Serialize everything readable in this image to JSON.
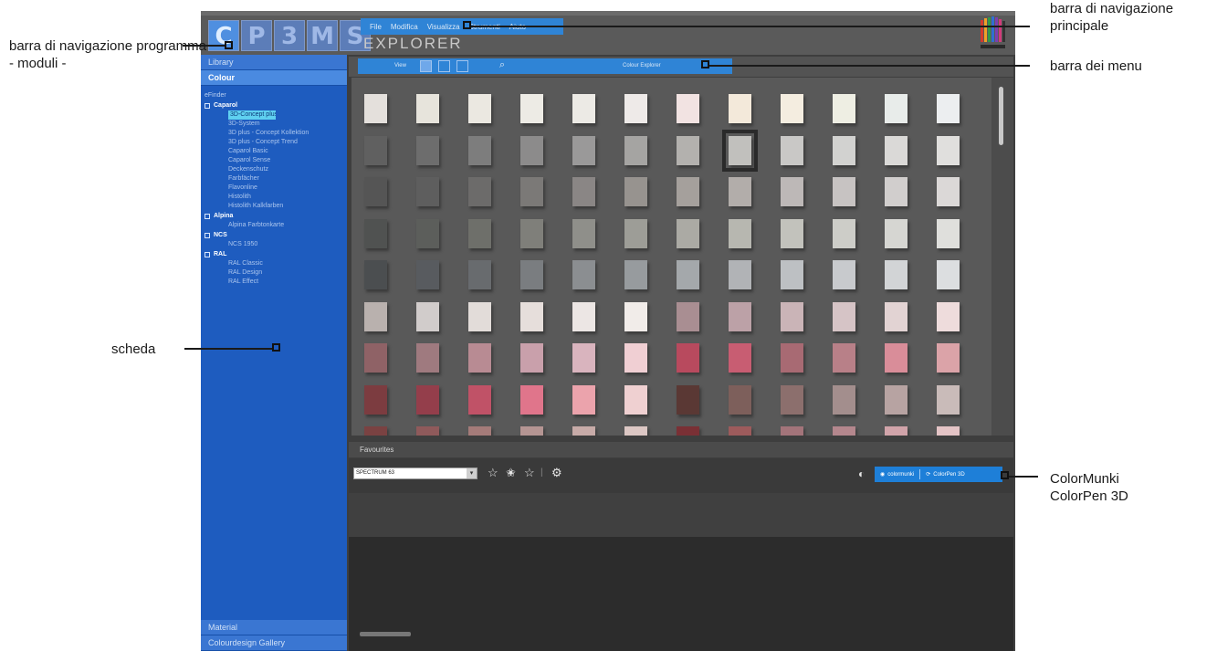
{
  "app": {
    "title": "EXPLORER",
    "modules": [
      "C",
      "P",
      "3",
      "M",
      "S"
    ],
    "main_menu": [
      "File",
      "Modifica",
      "Visualizza",
      "Strumenti",
      "Aiuto"
    ],
    "logo_icon": "brand-logo-icon"
  },
  "sidebar": {
    "headers": [
      "Library",
      "Colour"
    ],
    "tree_root": "eFinder",
    "groups": [
      {
        "name": "Caparol",
        "items": [
          "3D-Concept plus",
          "3D-System",
          "3D plus - Concept Kollektion",
          "3D plus - Concept Trend",
          "Caparol Basic",
          "Caparol Sense",
          "Deckenschutz",
          "Farbfächer",
          "Flavonline",
          "Histolith",
          "Histolith Kalkfarben"
        ]
      },
      {
        "name": "Alpina",
        "items": [
          "Alpina Farbtonkarte"
        ]
      },
      {
        "name": "NCS",
        "items": [
          "NCS 1950"
        ]
      },
      {
        "name": "RAL",
        "items": [
          "RAL Classic",
          "RAL Design",
          "RAL Effect"
        ]
      }
    ],
    "selected_item": "3D-Concept plus",
    "bottom_headers": [
      "Material",
      "Colourdesign Gallery"
    ]
  },
  "toolbar": {
    "view_label": "View",
    "status_text": "Colour Explorer",
    "search_icon": "search-icon"
  },
  "swatches": {
    "rows": [
      [
        "#e4e0dc",
        "#e7e4dc",
        "#ebe8e1",
        "#edebe5",
        "#eceae5",
        "#eeeae8",
        "#f2e3e2",
        "#f3e9da",
        "#f4ede0",
        "#eeeee3",
        "#e8ecea",
        "#eceef0"
      ],
      [
        "#606060",
        "#6d6d6d",
        "#7d7d7d",
        "#8c8b8b",
        "#9a9999",
        "#a5a4a2",
        "#b3b1ae",
        "#c1c0bd",
        "#c9c8c6",
        "#d2d2d0",
        "#dad9d7",
        "#e0dfdd"
      ],
      [
        "#555555",
        "#5e5e5e",
        "#6c6b6a",
        "#7b7977",
        "#8a8685",
        "#97938f",
        "#a5a09c",
        "#b2adaa",
        "#bdb8b7",
        "#c7c3c2",
        "#d1cecd",
        "#dbd8d7"
      ],
      [
        "#505251",
        "#5c5e5b",
        "#6e6f6a",
        "#7f7f7a",
        "#8f8f8a",
        "#9d9d97",
        "#abaaa4",
        "#b7b7b0",
        "#c2c2bc",
        "#cdcdc8",
        "#d6d6d2",
        "#dfdfdc"
      ],
      [
        "#4b4e50",
        "#585b5f",
        "#686b6e",
        "#7a7d80",
        "#8b8e91",
        "#979b9e",
        "#a4a8ab",
        "#b1b3b6",
        "#bdc0c3",
        "#c8cacd",
        "#d2d4d6",
        "#dcdee0"
      ],
      [
        "#b9b1ae",
        "#d1cccb",
        "#e2dcd9",
        "#e6dedb",
        "#ece6e4",
        "#f1ece9",
        "#a98e92",
        "#bca1a7",
        "#cab4b7",
        "#d6c4c6",
        "#e2d3d3",
        "#eedcdc"
      ],
      [
        "#8f6266",
        "#9f7a7f",
        "#b88b93",
        "#c9a0ab",
        "#d9b4be",
        "#f0cfd3",
        "#b84a5e",
        "#c85d72",
        "#a86a73",
        "#b88088",
        "#d98d99",
        "#dba3a8"
      ],
      [
        "#7c3c40",
        "#943e4b",
        "#c05267",
        "#e0758b",
        "#eba3ac",
        "#efd0d1",
        "#5a3834",
        "#7d5f5b",
        "#8c6f6d",
        "#a38e8d",
        "#b7a3a2",
        "#c9bbb9"
      ],
      [
        "#7a4242",
        "#8f5a5b",
        "#a47b79",
        "#b59593",
        "#c7aba8",
        "#dcc7c4",
        "#7a3035",
        "#9d5b5c",
        "#a3747a",
        "#b4878d",
        "#d1a4aa",
        "#e4c4c6"
      ]
    ],
    "selected_row": 1,
    "selected_col": 7
  },
  "favourites": {
    "title": "Favourites",
    "selected_palette": "SPECTRUM 63",
    "icons": [
      "star-outline-icon",
      "star-half-icon",
      "star-outline-icon",
      "gear-icon"
    ],
    "device_icon": "moon-icon",
    "devices": [
      "colormunki",
      "ColorPen 3D"
    ]
  },
  "callouts": {
    "modules": "barra di navigazione programma\n - moduli -",
    "main_nav": "barra di navigazione principale",
    "menu_bar": "barra dei menu",
    "tab": "scheda",
    "devices": "ColorMunki\nColorPen 3D"
  }
}
